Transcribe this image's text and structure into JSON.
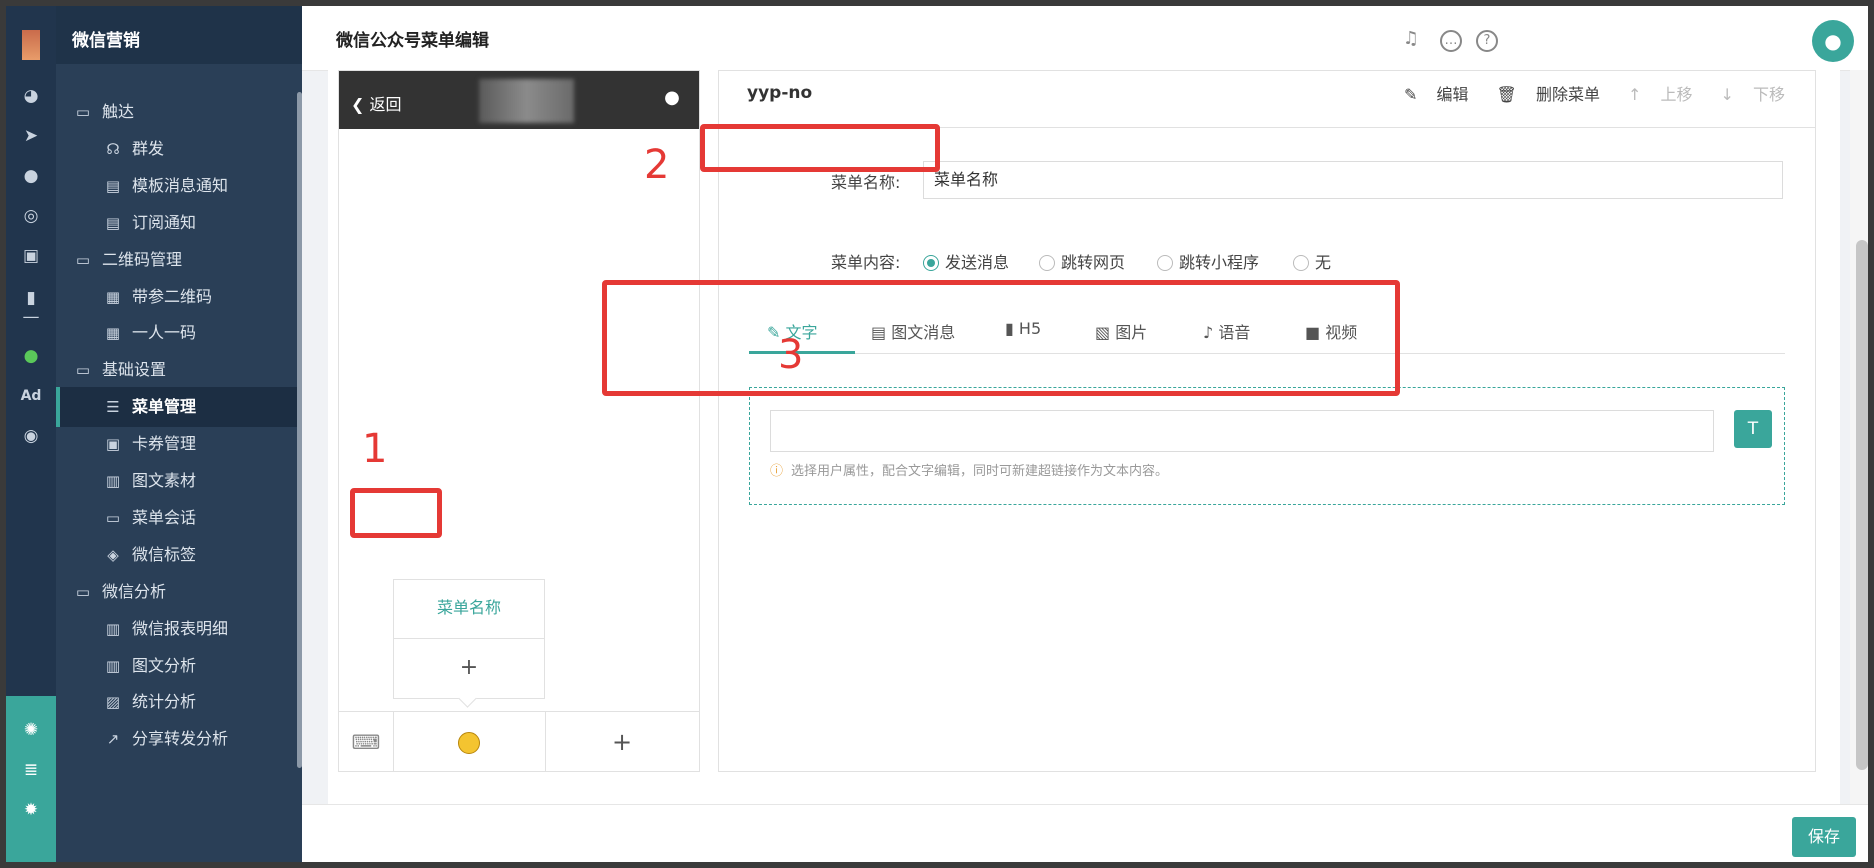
{
  "app": {
    "name": "微信营销"
  },
  "page": {
    "title": "微信公众号菜单编辑"
  },
  "sidebar": {
    "items": [
      {
        "label": "触达",
        "icon": "folder-icon",
        "level": 1
      },
      {
        "label": "群发",
        "icon": "broadcast-icon",
        "level": 2
      },
      {
        "label": "模板消息通知",
        "icon": "template-icon",
        "level": 2
      },
      {
        "label": "订阅通知",
        "icon": "subscribe-icon",
        "level": 2
      },
      {
        "label": "二维码管理",
        "icon": "folder-icon",
        "level": 1
      },
      {
        "label": "带参二维码",
        "icon": "qrcode-icon",
        "level": 2
      },
      {
        "label": "一人一码",
        "icon": "qrcode-icon",
        "level": 2
      },
      {
        "label": "基础设置",
        "icon": "folder-icon",
        "level": 1
      },
      {
        "label": "菜单管理",
        "icon": "list-icon",
        "level": 2,
        "active": true
      },
      {
        "label": "卡券管理",
        "icon": "coupon-icon",
        "level": 2
      },
      {
        "label": "图文素材",
        "icon": "article-icon",
        "level": 2
      },
      {
        "label": "菜单会话",
        "icon": "chat-icon",
        "level": 2
      },
      {
        "label": "微信标签",
        "icon": "tag-icon",
        "level": 2
      },
      {
        "label": "微信分析",
        "icon": "folder-icon",
        "level": 1
      },
      {
        "label": "微信报表明细",
        "icon": "report-icon",
        "level": 2
      },
      {
        "label": "图文分析",
        "icon": "report-icon",
        "level": 2
      },
      {
        "label": "统计分析",
        "icon": "chart-icon",
        "level": 2
      },
      {
        "label": "分享转发分析",
        "icon": "share-icon",
        "level": 2
      }
    ]
  },
  "rail": {
    "ad_label": "Ad"
  },
  "phone": {
    "back_label": "返回",
    "submenu_name": "菜单名称",
    "submenu_add": "+",
    "footer_add": "+"
  },
  "editor": {
    "menu_id": "yyp-no",
    "actions": {
      "edit": "编辑",
      "delete": "删除菜单",
      "move_up": "上移",
      "move_down": "下移"
    },
    "name_label": "菜单名称:",
    "name_value": "菜单名称",
    "content_label": "菜单内容:",
    "content_options": [
      "发送消息",
      "跳转网页",
      "跳转小程序",
      "无"
    ],
    "content_selected": "发送消息",
    "tabs": [
      "文字",
      "图文消息",
      "H5",
      "图片",
      "语音",
      "视频"
    ],
    "active_tab": "文字",
    "hint": "选择用户属性，配合文字编辑，同时可新建超链接作为文本内容。"
  },
  "annotations": [
    "1",
    "2",
    "3"
  ],
  "footer": {
    "save_label": "保存"
  },
  "colors": {
    "accent": "#3aa69b",
    "sidebar": "#2a3f57",
    "annotation": "#e53935"
  }
}
